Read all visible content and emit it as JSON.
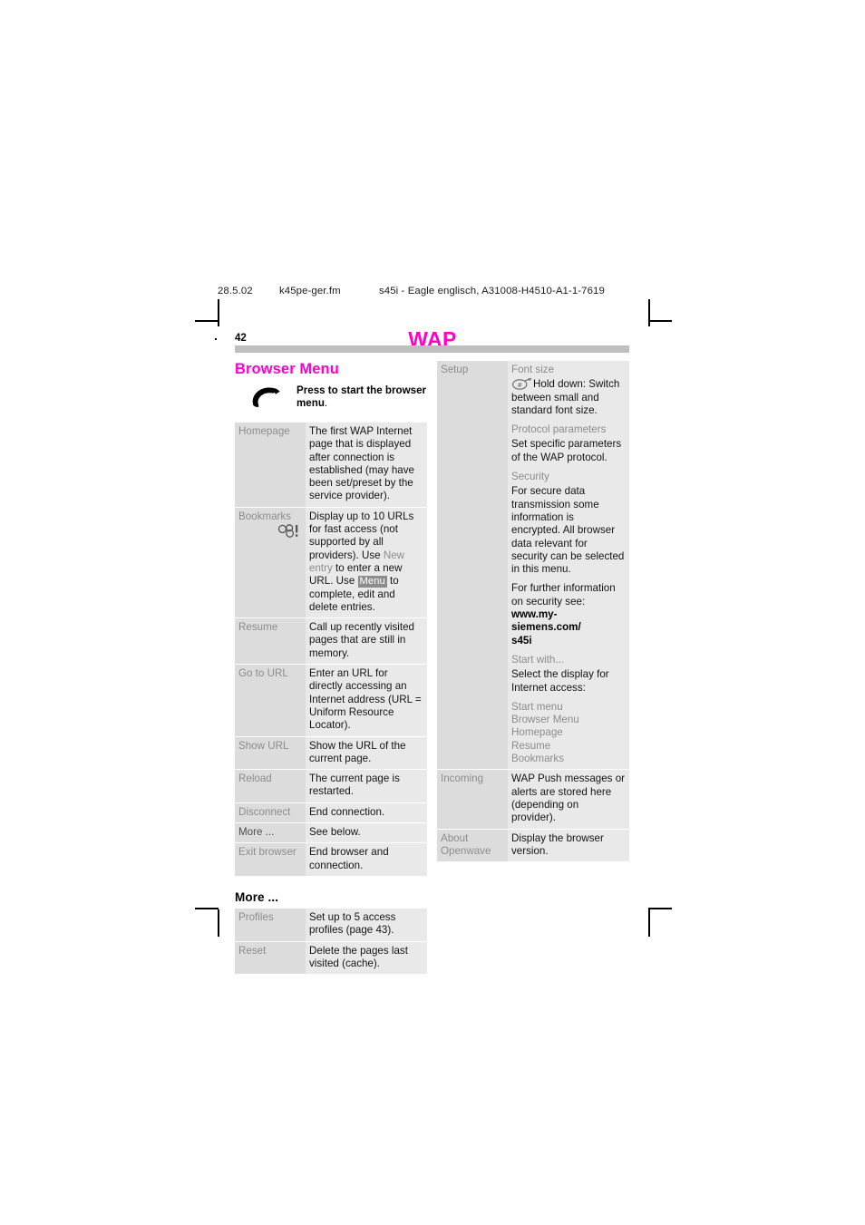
{
  "running_header": {
    "date": "28.5.02",
    "filename": "k45pe-ger.fm",
    "reference": "s45i - Eagle englisch, A31008-H4510-A1-1-7619"
  },
  "page_head": {
    "folio": "42",
    "chapter_title": "WAP",
    "chapter_color": "#ff00cc"
  },
  "left_column": {
    "section_title": "Browser Menu",
    "note": {
      "icon": "phone-handset-icon",
      "text_bold": "Press to start the browser menu",
      "text_tail": "."
    },
    "rows": [
      {
        "key": "Homepage",
        "value": "The first WAP Internet page that is displayed after connection is established (may have been set/preset by the service provider)."
      },
      {
        "key": "Bookmarks",
        "icon": "bookmarks-icon",
        "value_p1": "Display up to 10 URLs for fast access (not supported by all providers).",
        "value_p2_pre": "Use ",
        "value_p2_soft": "New entry",
        "value_p2_post": " to enter a new URL.",
        "value_p3_pre": "Use ",
        "value_p3_chip": "Menu",
        "value_p3_post": " to complete, edit and delete entries."
      },
      {
        "key": "Resume",
        "value": "Call up recently visited pages that are still in memory."
      },
      {
        "key": "Go to URL",
        "value": "Enter an URL for directly accessing an Internet address (URL = Uniform Resource Locator)."
      },
      {
        "key": "Show URL",
        "value": "Show the URL of the current page."
      },
      {
        "key": "Reload",
        "value": "The current page is restarted."
      },
      {
        "key": "Disconnect",
        "value": "End connection."
      },
      {
        "key": "More ...",
        "value": "See below."
      },
      {
        "key": "Exit browser",
        "value": "End browser and connection."
      }
    ],
    "subsection_title": "More ...",
    "more_rows": [
      {
        "key": "Profiles",
        "value": "Set up to 5 access profiles (page 43)."
      },
      {
        "key": "Reset",
        "value": "Delete the pages last visited (cache)."
      }
    ]
  },
  "right_column": {
    "rows": [
      {
        "key": "Setup",
        "font_size_head": "Font size",
        "font_size_icon": "hash-key-icon",
        "font_size_text": "Hold down: Switch between small and standard font size.",
        "protocol_head": "Protocol parameters",
        "protocol_text": "Set specific parameters of the WAP protocol.",
        "security_head": "Security",
        "security_text1": "For secure data transmission some information is encrypted. All browser data relevant for security can be selected in this menu.",
        "security_text2": "For further information on security see:",
        "security_url_line1": "www.my-siemens.com/",
        "security_url_line2": "s45i",
        "start_with_head": "Start with...",
        "start_with_text": "Select the display for Internet access:",
        "start_with_options": [
          "Start menu",
          "Browser Menu",
          "Homepage",
          "Resume",
          "Bookmarks"
        ]
      },
      {
        "key": "Incoming",
        "value": "WAP Push messages or alerts are stored here (depending on provider)."
      },
      {
        "key_line1": "About",
        "key_line2": "Openwave",
        "value": "Display the browser version."
      }
    ]
  }
}
